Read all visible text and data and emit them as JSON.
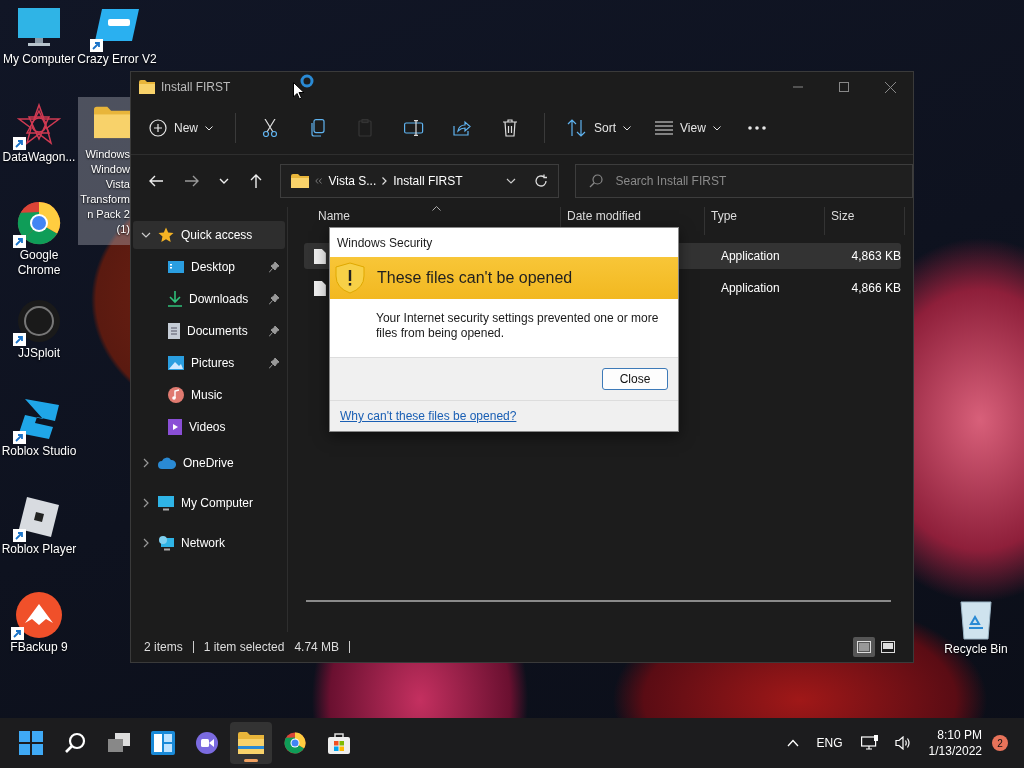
{
  "desktop": {
    "icons": [
      {
        "label": "My Computer",
        "kind": "monitor",
        "shortcut": false,
        "selected": false
      },
      {
        "label": "DataWagon...",
        "kind": "star-logo",
        "shortcut": true,
        "selected": false
      },
      {
        "label": "Google\nChrome",
        "kind": "chrome",
        "shortcut": true,
        "selected": false
      },
      {
        "label": "JJSploit",
        "kind": "wrd-logo",
        "shortcut": true,
        "selected": false
      },
      {
        "label": "Roblox Studio",
        "kind": "studio",
        "shortcut": true,
        "selected": false
      },
      {
        "label": "Roblox Player",
        "kind": "player",
        "shortcut": true,
        "selected": false
      },
      {
        "label": "FBackup 9",
        "kind": "fbackup",
        "shortcut": true,
        "selected": false
      },
      {
        "label": "Crazy Error V2",
        "kind": "error-window",
        "shortcut": true,
        "selected": false
      },
      {
        "label": "Windows\nWindow\nVista\nTransform\nn Pack 2\n(1)",
        "kind": "folder",
        "shortcut": false,
        "selected": true
      }
    ],
    "recycle_bin": {
      "label": "Recycle Bin"
    }
  },
  "explorer": {
    "title": "Install FIRST",
    "toolbar": [
      {
        "kind": "new",
        "label": "New",
        "disabled": false
      },
      {
        "kind": "separator"
      },
      {
        "kind": "cut",
        "disabled": false
      },
      {
        "kind": "copy",
        "disabled": false
      },
      {
        "kind": "paste",
        "disabled": true
      },
      {
        "kind": "rename",
        "disabled": false
      },
      {
        "kind": "share",
        "disabled": false
      },
      {
        "kind": "delete",
        "disabled": false
      },
      {
        "kind": "separator"
      },
      {
        "kind": "sort",
        "label": "Sort",
        "disabled": false
      },
      {
        "kind": "view",
        "label": "View",
        "disabled": false
      },
      {
        "kind": "more",
        "disabled": false
      }
    ],
    "address": {
      "crumbs": [
        "Vista S...",
        "Install FIRST"
      ]
    },
    "search": {
      "placeholder": "Search Install FIRST"
    },
    "sidebar": {
      "items": [
        {
          "label": "Quick access",
          "kind": "star",
          "expanded": true,
          "selected": true,
          "children": [
            {
              "label": "Desktop",
              "kind": "desktop",
              "pinned": true,
              "selected": false
            },
            {
              "label": "Downloads",
              "kind": "downloads",
              "pinned": true,
              "selected": false
            },
            {
              "label": "Documents",
              "kind": "documents",
              "pinned": true,
              "selected": false
            },
            {
              "label": "Pictures",
              "kind": "pictures",
              "pinned": true,
              "selected": false
            },
            {
              "label": "Music",
              "kind": "music",
              "pinned": false,
              "selected": false
            },
            {
              "label": "Videos",
              "kind": "videos",
              "pinned": false,
              "selected": false
            }
          ]
        },
        {
          "label": "OneDrive",
          "kind": "cloud",
          "expanded": false,
          "selected": false
        },
        {
          "label": "My Computer",
          "kind": "computer",
          "expanded": false,
          "selected": false
        },
        {
          "label": "Network",
          "kind": "network",
          "expanded": false,
          "selected": false
        }
      ]
    },
    "file_list": {
      "columns": [
        {
          "label": "Name",
          "sorted": true
        },
        {
          "label": "Date modified",
          "sorted": false
        },
        {
          "label": "Type",
          "sorted": false
        },
        {
          "label": "Size",
          "sorted": false
        }
      ],
      "rows": [
        {
          "type": "Application",
          "size": "4,863 KB",
          "selected": true
        },
        {
          "type": "Application",
          "size": "4,866 KB",
          "selected": false
        }
      ]
    },
    "status_bar": {
      "items": "2 items",
      "selection": "1 item selected",
      "size": "4.74 MB",
      "view_modes": [
        {
          "kind": "details",
          "selected": true
        },
        {
          "kind": "tiles",
          "selected": false
        }
      ]
    }
  },
  "dialog": {
    "title": "Windows Security",
    "heading": "These files can't be opened",
    "message": "Your Internet security settings prevented one or more files from being opened.",
    "button": "Close",
    "link": "Why can't these files be opened?"
  },
  "taskbar": {
    "apps": [
      {
        "kind": "start",
        "active": false
      },
      {
        "kind": "search",
        "active": false
      },
      {
        "kind": "task-view",
        "active": false
      },
      {
        "kind": "widgets",
        "active": false
      },
      {
        "kind": "chat",
        "active": false
      },
      {
        "kind": "explorer",
        "active": true
      },
      {
        "kind": "chrome",
        "active": false
      },
      {
        "kind": "store",
        "active": false
      }
    ],
    "language": "ENG",
    "time": "8:10 PM",
    "date": "1/13/2022",
    "notifications": "2"
  }
}
